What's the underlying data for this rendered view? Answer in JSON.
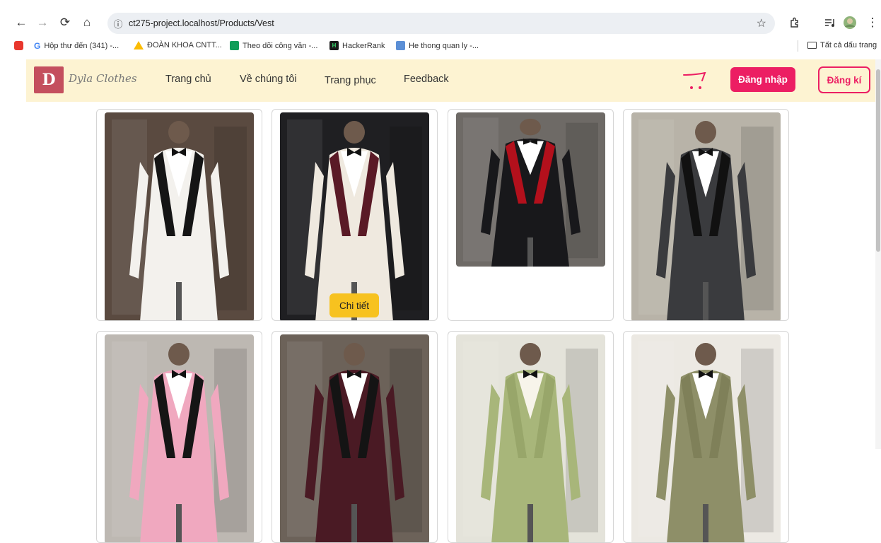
{
  "browser": {
    "url": "ct275-project.localhost/Products/Vest",
    "bookmarks": [
      {
        "label": "",
        "color": "#e8372d"
      },
      {
        "label": "Hộp thư đến (341) -...",
        "color": "#4285f4"
      },
      {
        "label": "ĐOÀN KHOA CNTT...",
        "color": "#fbbc04"
      },
      {
        "label": "Theo dõi công văn -...",
        "color": "#0f9d58"
      },
      {
        "label": "HackerRank",
        "color": "#1a1a1a"
      },
      {
        "label": "He thong quan ly -...",
        "color": "#5b8fd6"
      }
    ],
    "all_bookmarks": "Tất cả dấu trang"
  },
  "site": {
    "logo_mark": "D",
    "logo_text": "Dyla Clothes",
    "nav": [
      "Trang chủ",
      "Về chúng tôi",
      "Trang phục",
      "Feedback"
    ],
    "login_label": "Đăng nhập",
    "signup_label": "Đăng kí",
    "accent_color": "#ec1e63",
    "nav_bg": "#fdf3d2"
  },
  "products": {
    "detail_label": "Chi tiết",
    "items": [
      {
        "name": "white-black-lapel-tuxedo",
        "jacket": "#f3f1ed",
        "lapel": "#151515",
        "bg": "#5a4a40",
        "shirt": "#ffffff"
      },
      {
        "name": "cream-burgundy-tuxedo",
        "jacket": "#efe9df",
        "lapel": "#5a1a26",
        "bg": "#1f1f22",
        "shirt": "#ffffff",
        "hover": true
      },
      {
        "name": "black-red-tuxedo",
        "jacket": "#18181b",
        "lapel": "#b3101c",
        "bg": "#6e6a66",
        "shirt": "#ffffff"
      },
      {
        "name": "charcoal-vest-suit",
        "jacket": "#3a3b3e",
        "lapel": "#111111",
        "bg": "#b8b3a8",
        "shirt": "#ffffff"
      },
      {
        "name": "pink-tuxedo",
        "jacket": "#f0a8bf",
        "lapel": "#151515",
        "bg": "#bdb8b2",
        "shirt": "#ffffff"
      },
      {
        "name": "burgundy-tuxedo",
        "jacket": "#4a1a24",
        "lapel": "#141414",
        "bg": "#6c6259",
        "shirt": "#ffffff"
      },
      {
        "name": "sage-green-blazer",
        "jacket": "#a8b67a",
        "lapel": "#98a66a",
        "bg": "#e4e3da",
        "shirt": "#f7f4ea"
      },
      {
        "name": "olive-pantsuit",
        "jacket": "#8e8f68",
        "lapel": "#7f8059",
        "bg": "#ece9e3",
        "shirt": "#ffffff"
      }
    ]
  }
}
